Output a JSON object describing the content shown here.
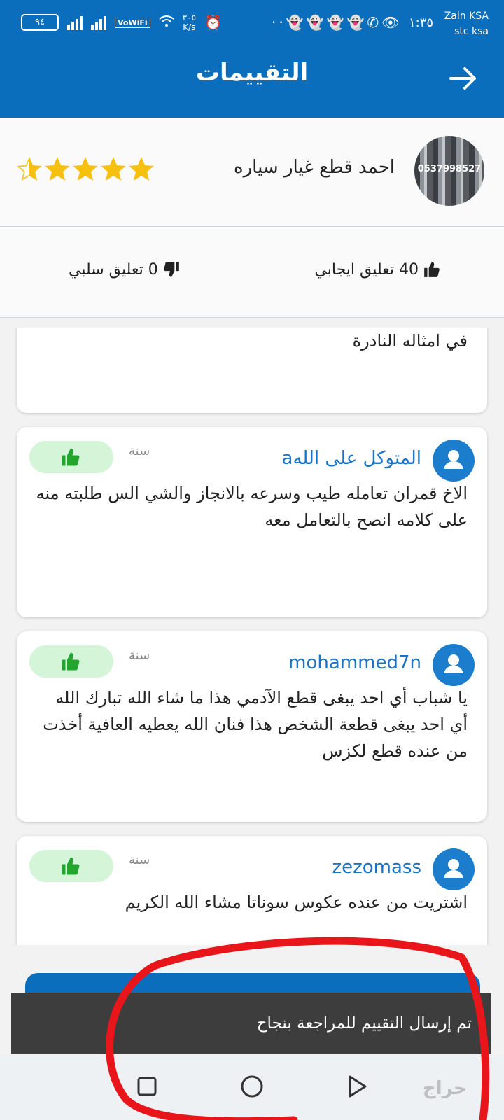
{
  "status_bar": {
    "carrier_1": "Zain KSA",
    "carrier_2": "stc ksa",
    "time": "١:٣٥",
    "battery": "٩٤",
    "speed_value": "٣٠٥",
    "speed_unit": "K/s",
    "volte": "VoWiFi"
  },
  "header": {
    "title": "التقييمات"
  },
  "merchant": {
    "name": "احمد قطع غيار سياره",
    "avatar_text": "0537998527",
    "rating": 4.5,
    "star_color": "#f6c00e"
  },
  "counts": {
    "positive": "40 تعليق ايجابي",
    "negative": "0 تعليق سلبي"
  },
  "reviews": [
    {
      "user": "",
      "time": "",
      "text": "في امثاله النادرة"
    },
    {
      "user": "المتوكل على اللهa",
      "time": "سنة",
      "text": "الاخ قمران تعامله طيب وسرعه بالانجاز والشي الس طلبته منه على كلامه انصح بالتعامل معه"
    },
    {
      "user": "mohammed7n",
      "time": "سنة",
      "text": "يا شباب أي احد يبغى قطع الآدمي هذا ما شاء الله تبارك الله أي احد يبغى قطعة الشخص هذا فنان الله يعطيه العافية أخذت من عنده قطع لكزس"
    },
    {
      "user": "zezomass",
      "time": "سنة",
      "text": "اشتريت من عنده عكوس سوناتا مشاء الله الكريم"
    }
  ],
  "toast": {
    "message": "تم إرسال التقييم للمراجعة بنجاح"
  },
  "watermark": "حراج",
  "colors": {
    "primary": "#0a6ebd",
    "like_bg": "#d4f5d8",
    "like_icon": "#22a62e",
    "annotation": "#e8151b"
  }
}
